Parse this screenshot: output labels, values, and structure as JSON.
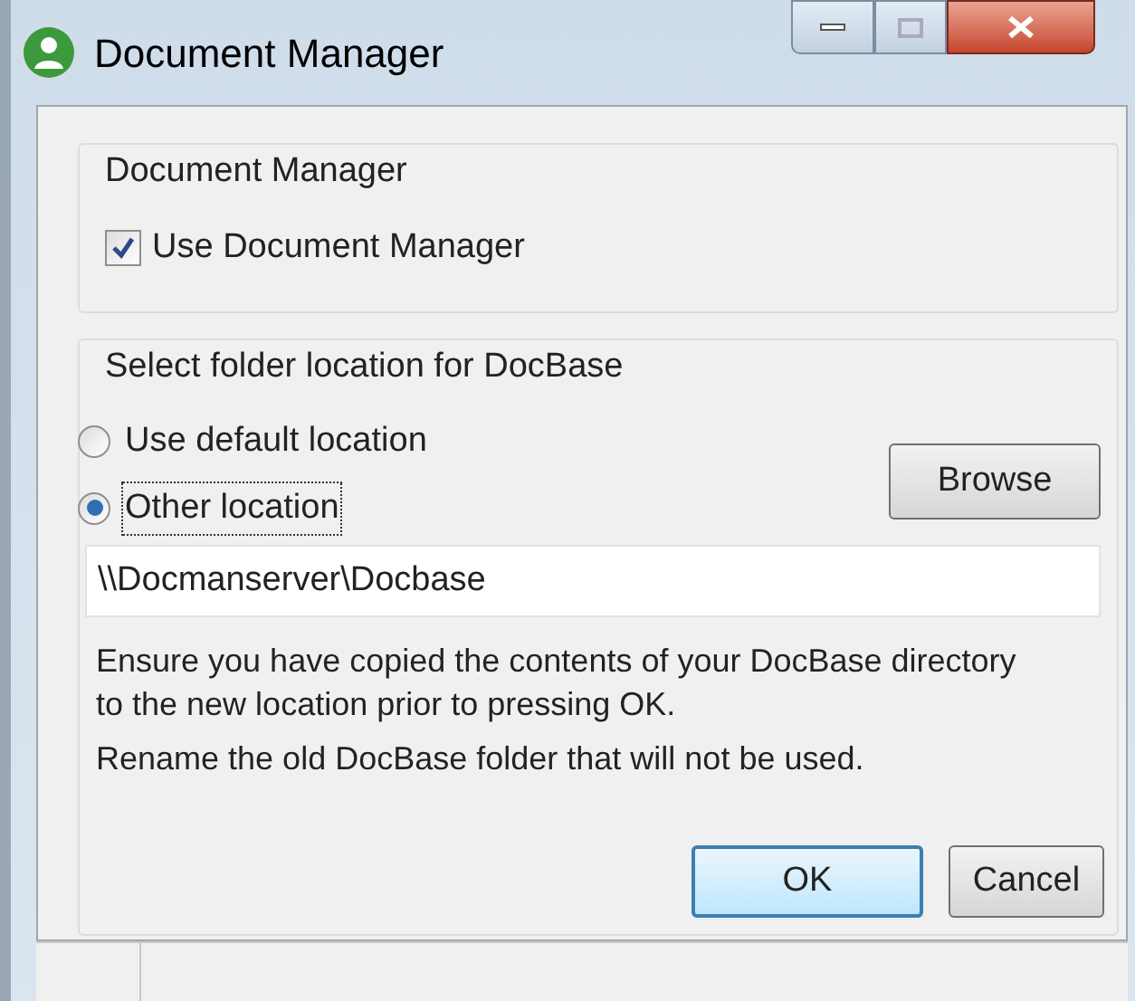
{
  "window": {
    "title": "Document Manager"
  },
  "group_document_manager": {
    "title": "Document Manager",
    "checkbox": {
      "label": "Use Document Manager",
      "checked": true
    }
  },
  "group_folder": {
    "title": "Select folder location for DocBase",
    "radios": [
      {
        "label": "Use default location",
        "selected": false
      },
      {
        "label": "Other location",
        "selected": true
      }
    ],
    "browse_button": "Browse",
    "path_field": {
      "value": "\\\\Docmanserver\\Docbase"
    },
    "notes": [
      "Ensure you have copied the contents of your DocBase directory to the new location prior to pressing OK.",
      "Rename the old DocBase folder that will not be used."
    ]
  },
  "buttons": [
    {
      "label": "OK",
      "focused": true
    },
    {
      "label": "Cancel",
      "focused": false
    }
  ]
}
